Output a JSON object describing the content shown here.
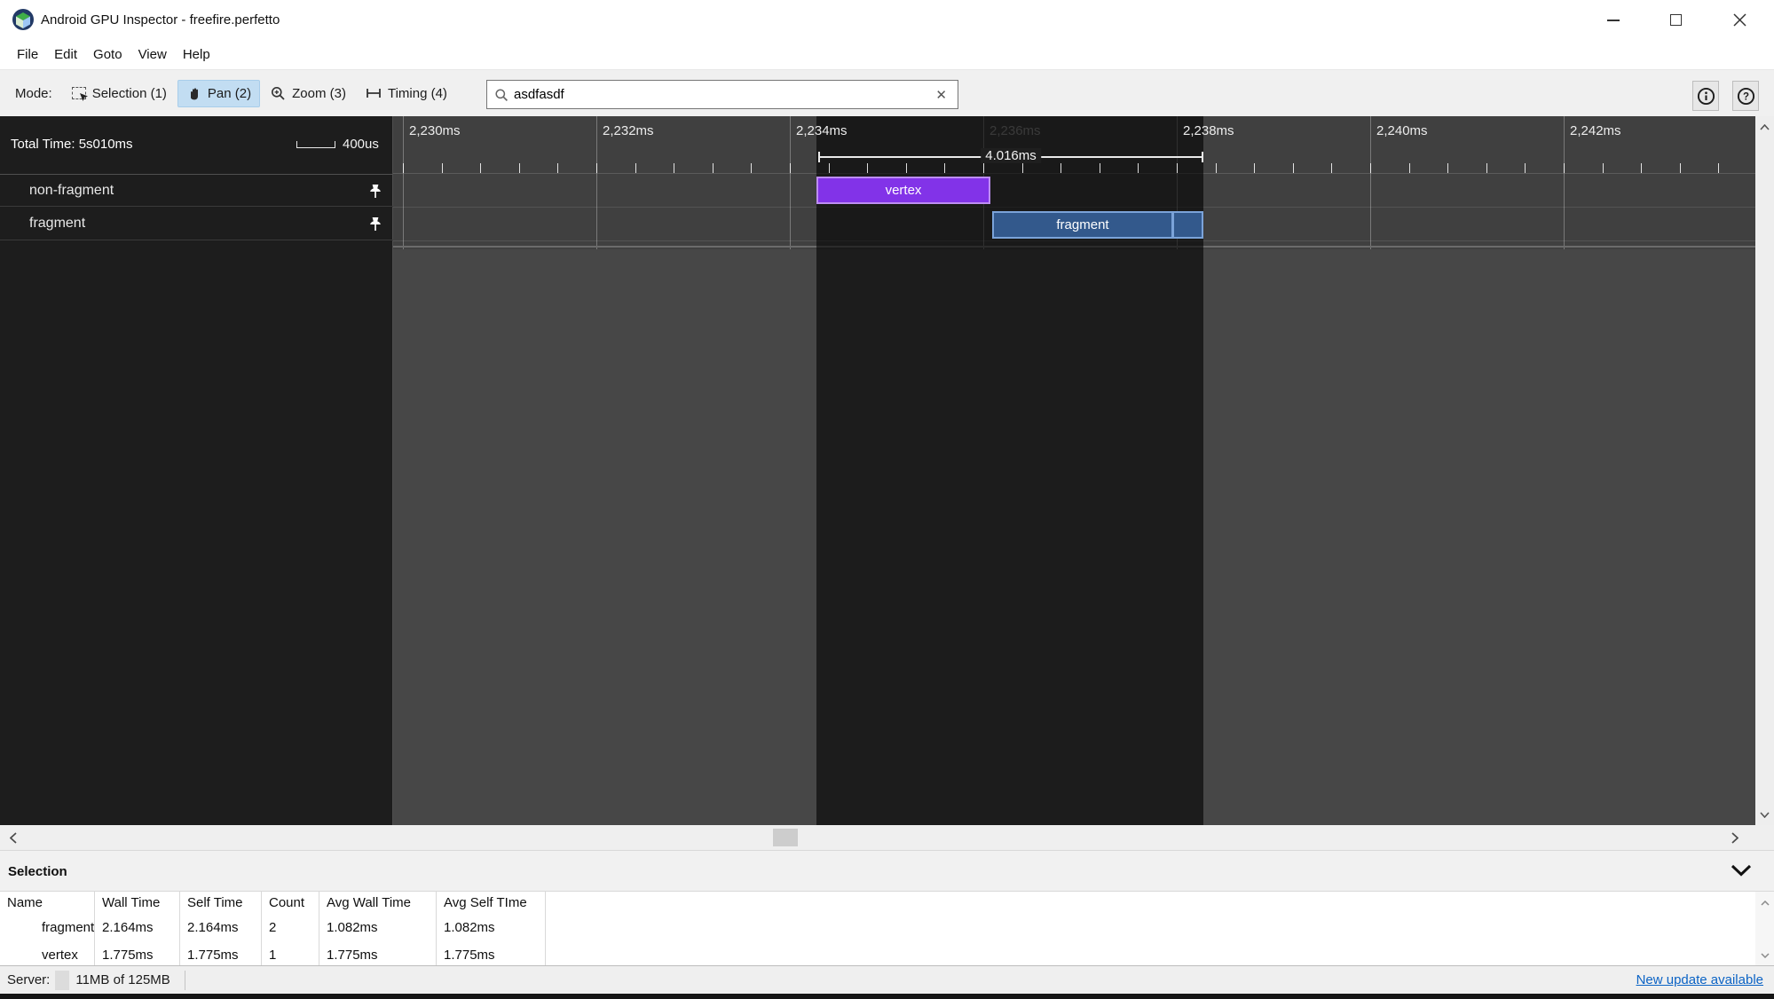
{
  "window": {
    "title": "Android GPU Inspector - freefire.perfetto"
  },
  "menu": {
    "items": [
      "File",
      "Edit",
      "Goto",
      "View",
      "Help"
    ]
  },
  "toolbar": {
    "mode_label": "Mode:",
    "modes": [
      {
        "label": "Selection (1)",
        "icon": "selection-cursor-icon",
        "active": false
      },
      {
        "label": "Pan (2)",
        "icon": "hand-icon",
        "active": true
      },
      {
        "label": "Zoom (3)",
        "icon": "zoom-in-icon",
        "active": false
      },
      {
        "label": "Timing (4)",
        "icon": "timing-icon",
        "active": false
      }
    ],
    "search": {
      "value": "asdfasdf",
      "clear_glyph": "✕"
    },
    "info_button_glyph": "i",
    "help_button_glyph": "?"
  },
  "timeline": {
    "total_time": "Total Time: 5s010ms",
    "scale_label": "400us",
    "ruler_labels": [
      {
        "text": "2,230ms",
        "dim": false
      },
      {
        "text": "2,232ms",
        "dim": false
      },
      {
        "text": "2,234ms",
        "dim": false
      },
      {
        "text": "2,236ms",
        "dim": true
      },
      {
        "text": "2,238ms",
        "dim": false
      },
      {
        "text": "2,240ms",
        "dim": false
      },
      {
        "text": "2,242ms",
        "dim": false
      }
    ],
    "measurement": {
      "label": "4.016ms"
    },
    "tracks": [
      {
        "name": "non-fragment"
      },
      {
        "name": "fragment"
      }
    ],
    "bars": [
      {
        "label": "vertex",
        "fill": "#8233e8",
        "border": "#bd8df2"
      },
      {
        "label": "fragment",
        "fill": "#33598c",
        "border": "#7ba3d9"
      }
    ]
  },
  "selection": {
    "title": "Selection",
    "table": {
      "columns": [
        "Name",
        "Wall Time",
        "Self Time",
        "Count",
        "Avg Wall Time",
        "Avg Self TIme"
      ],
      "rows": [
        [
          "fragment",
          "2.164ms",
          "2.164ms",
          "2",
          "1.082ms",
          "1.082ms"
        ],
        [
          "vertex",
          "1.775ms",
          "1.775ms",
          "1",
          "1.775ms",
          "1.775ms"
        ]
      ]
    }
  },
  "status_bar": {
    "server_label": "Server:",
    "memory": "11MB of 125MB",
    "update_link": "New update available"
  },
  "colors": {
    "vertex_fill": "#8233e8",
    "vertex_border": "#bd8df2",
    "fragment_fill": "#33598c",
    "fragment_border": "#7ba3d9",
    "pan_active_bg": "#c2ddf2",
    "link": "#0b63c5"
  }
}
